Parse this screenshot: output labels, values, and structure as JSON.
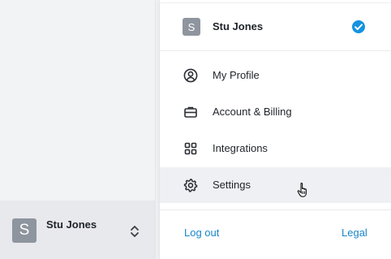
{
  "sidebar": {
    "account": {
      "avatar_letter": "S",
      "name": "Stu Jones"
    }
  },
  "menu": {
    "current_account": {
      "avatar_letter": "S",
      "name": "Stu Jones"
    },
    "items": [
      {
        "label": "My Profile",
        "icon": "user-circle-icon"
      },
      {
        "label": "Account & Billing",
        "icon": "briefcase-icon"
      },
      {
        "label": "Integrations",
        "icon": "grid-icon"
      },
      {
        "label": "Settings",
        "icon": "gear-icon",
        "hovered": true
      }
    ],
    "footer": {
      "logout_label": "Log out",
      "legal_label": "Legal"
    }
  },
  "colors": {
    "accent": "#1a86c8",
    "check_badge": "#1493e0",
    "avatar_bg": "#8f959e"
  }
}
